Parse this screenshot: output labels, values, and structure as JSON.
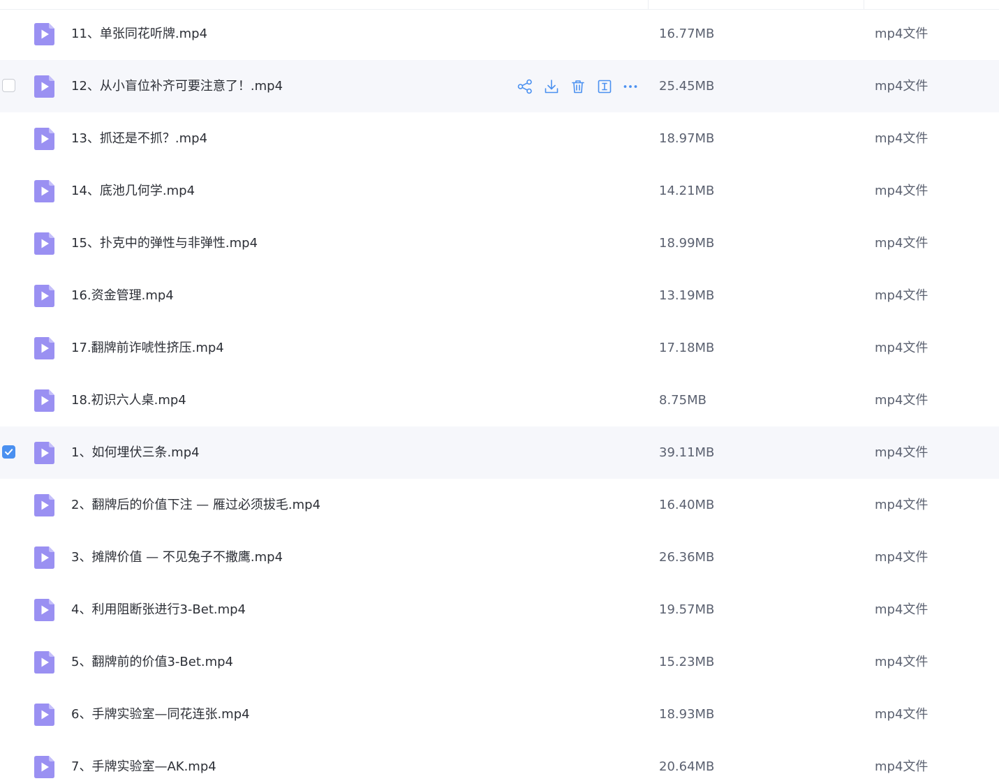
{
  "colors": {
    "accent": "#4a90f0",
    "icon_purple": "#8f86f0",
    "hover_bg": "#f6f7fb"
  },
  "row_actions": [
    {
      "name": "share",
      "icon": "share-icon"
    },
    {
      "name": "download",
      "icon": "download-icon"
    },
    {
      "name": "delete",
      "icon": "trash-icon"
    },
    {
      "name": "rename",
      "icon": "rename-icon"
    },
    {
      "name": "more",
      "icon": "more-icon"
    }
  ],
  "files": [
    {
      "name": "11、单张同花听牌.mp4",
      "size": "16.77MB",
      "type": "mp4文件",
      "state": "normal"
    },
    {
      "name": "12、从小盲位补齐可要注意了！.mp4",
      "size": "25.45MB",
      "type": "mp4文件",
      "state": "hovered"
    },
    {
      "name": "13、抓还是不抓？.mp4",
      "size": "18.97MB",
      "type": "mp4文件",
      "state": "normal"
    },
    {
      "name": "14、底池几何学.mp4",
      "size": "14.21MB",
      "type": "mp4文件",
      "state": "normal"
    },
    {
      "name": "15、扑克中的弹性与非弹性.mp4",
      "size": "18.99MB",
      "type": "mp4文件",
      "state": "normal"
    },
    {
      "name": "16.资金管理.mp4",
      "size": "13.19MB",
      "type": "mp4文件",
      "state": "normal"
    },
    {
      "name": "17.翻牌前诈唬性挤压.mp4",
      "size": "17.18MB",
      "type": "mp4文件",
      "state": "normal"
    },
    {
      "name": "18.初识六人桌.mp4",
      "size": "8.75MB",
      "type": "mp4文件",
      "state": "normal"
    },
    {
      "name": "1、如何埋伏三条.mp4",
      "size": "39.11MB",
      "type": "mp4文件",
      "state": "selected"
    },
    {
      "name": "2、翻牌后的价值下注 — 雁过必须拔毛.mp4",
      "size": "16.40MB",
      "type": "mp4文件",
      "state": "normal"
    },
    {
      "name": "3、摊牌价值 — 不见兔子不撒鹰.mp4",
      "size": "26.36MB",
      "type": "mp4文件",
      "state": "normal"
    },
    {
      "name": "4、利用阻断张进行3-Bet.mp4",
      "size": "19.57MB",
      "type": "mp4文件",
      "state": "normal"
    },
    {
      "name": "5、翻牌前的价值3-Bet.mp4",
      "size": "15.23MB",
      "type": "mp4文件",
      "state": "normal"
    },
    {
      "name": "6、手牌实验室—同花连张.mp4",
      "size": "18.93MB",
      "type": "mp4文件",
      "state": "normal"
    },
    {
      "name": "7、手牌实验室—AK.mp4",
      "size": "20.64MB",
      "type": "mp4文件",
      "state": "normal"
    }
  ]
}
